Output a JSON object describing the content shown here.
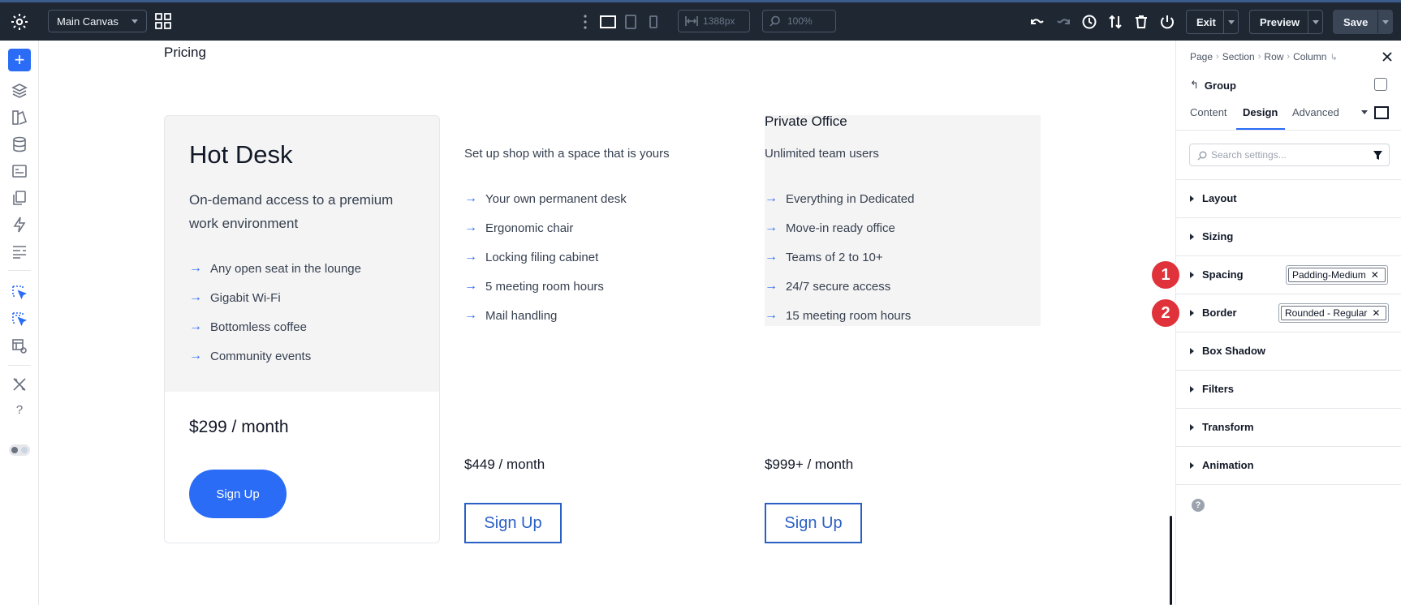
{
  "topbar": {
    "canvas_select": "Main Canvas",
    "width_value": "1388px",
    "zoom_value": "100%",
    "exit_label": "Exit",
    "preview_label": "Preview",
    "save_label": "Save"
  },
  "canvas": {
    "section_label": "Pricing",
    "plans": [
      {
        "title": "Hot Desk",
        "subtitle": "On-demand access to a premium work environment",
        "features": [
          "Any open seat in the lounge",
          "Gigabit Wi-Fi",
          "Bottomless coffee",
          "Community events"
        ],
        "price": "$299 / month",
        "cta": "Sign Up"
      },
      {
        "title": "",
        "subtitle": "Set up shop with a space that is yours",
        "features": [
          "Your own permanent desk",
          "Ergonomic chair",
          "Locking filing cabinet",
          "5 meeting room hours",
          "Mail handling"
        ],
        "price": "$449 / month",
        "cta": "Sign Up"
      },
      {
        "title": "Private Office",
        "subtitle": "Unlimited team users",
        "features": [
          "Everything in Dedicated",
          "Move-in ready office",
          "Teams of 2 to 10+",
          "24/7 secure access",
          "15 meeting room hours"
        ],
        "price": "$999+ / month",
        "cta": "Sign Up"
      }
    ],
    "feature_arrow": "→"
  },
  "panel": {
    "breadcrumbs": [
      "Page",
      "Section",
      "Row",
      "Column"
    ],
    "element_label": "Group",
    "tabs": [
      "Content",
      "Design",
      "Advanced"
    ],
    "active_tab": "Design",
    "search_placeholder": "Search settings...",
    "sections": [
      {
        "label": "Layout",
        "preset": ""
      },
      {
        "label": "Sizing",
        "preset": ""
      },
      {
        "label": "Spacing",
        "preset": "Padding-Medium"
      },
      {
        "label": "Border",
        "preset": "Rounded - Regular"
      },
      {
        "label": "Box Shadow",
        "preset": ""
      },
      {
        "label": "Filters",
        "preset": ""
      },
      {
        "label": "Transform",
        "preset": ""
      },
      {
        "label": "Animation",
        "preset": ""
      }
    ],
    "help_glyph": "?"
  },
  "annotations": [
    "1",
    "2"
  ],
  "colors": {
    "topbar_bg": "#1f2733",
    "accent_blue": "#2a6cf6",
    "badge_red": "#e0323a",
    "card_bg": "#f4f4f4"
  }
}
